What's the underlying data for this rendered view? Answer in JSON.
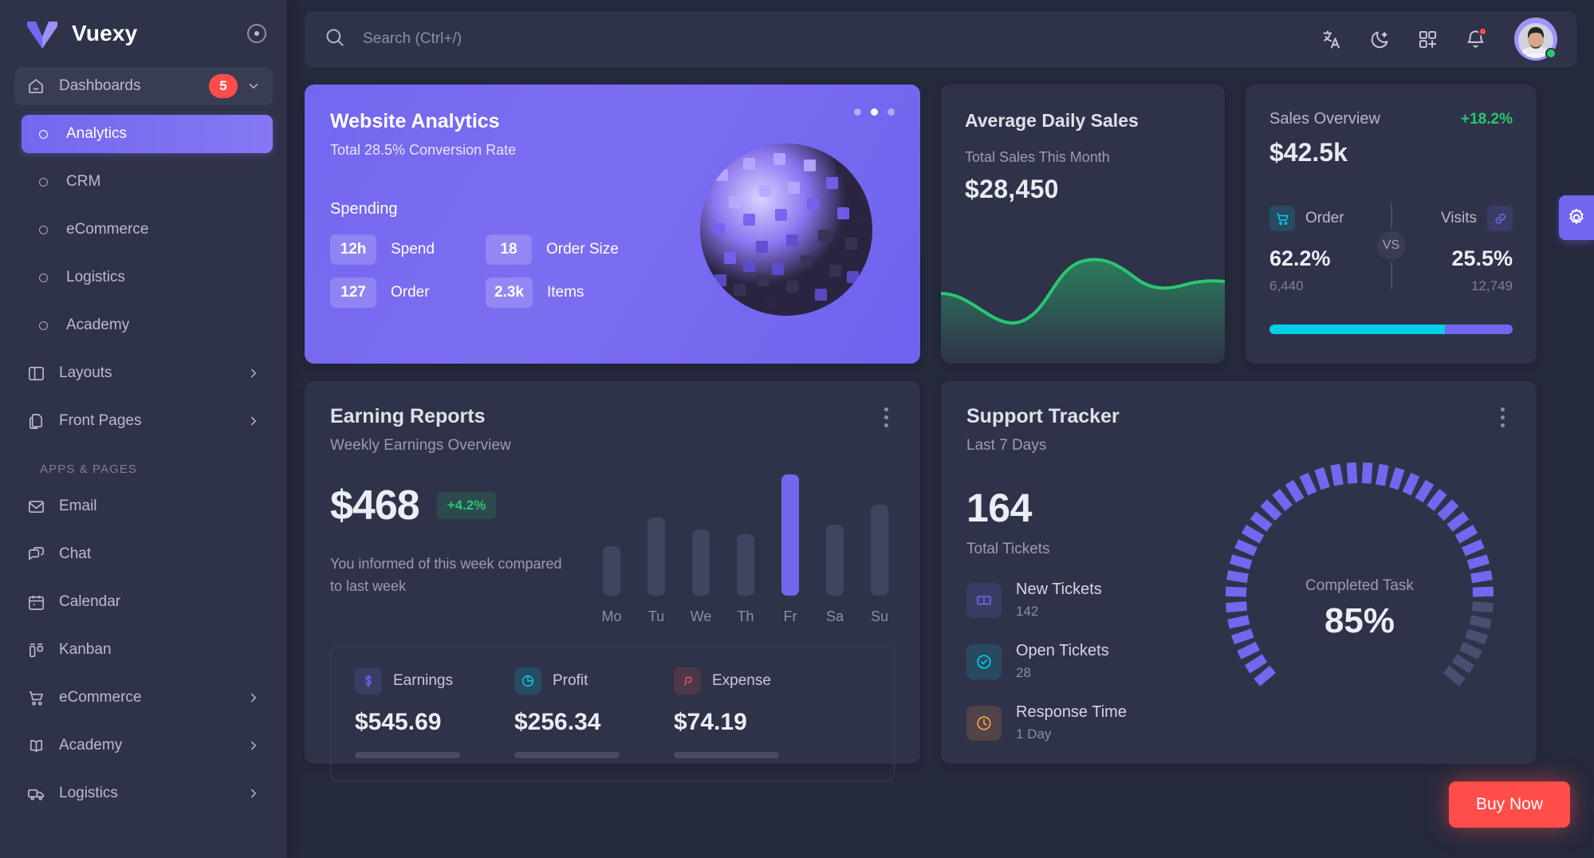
{
  "brand": {
    "name": "Vuexy",
    "collapse_icon": "circle-dot-icon"
  },
  "sidebar": {
    "group": {
      "label": "Dashboards",
      "badge": "5",
      "icon": "home-icon"
    },
    "dash_items": [
      {
        "label": "Analytics",
        "active": true
      },
      {
        "label": "CRM",
        "active": false
      },
      {
        "label": "eCommerce",
        "active": false
      },
      {
        "label": "Logistics",
        "active": false
      },
      {
        "label": "Academy",
        "active": false
      }
    ],
    "top_items": [
      {
        "label": "Layouts",
        "icon": "layout-icon",
        "arrow": true
      },
      {
        "label": "Front Pages",
        "icon": "pages-icon",
        "arrow": true
      }
    ],
    "section_label": "APPS & PAGES",
    "app_items": [
      {
        "label": "Email",
        "icon": "mail-icon",
        "arrow": false
      },
      {
        "label": "Chat",
        "icon": "chat-icon",
        "arrow": false
      },
      {
        "label": "Calendar",
        "icon": "calendar-icon",
        "arrow": false
      },
      {
        "label": "Kanban",
        "icon": "kanban-icon",
        "arrow": false
      },
      {
        "label": "eCommerce",
        "icon": "cart-icon",
        "arrow": true
      },
      {
        "label": "Academy",
        "icon": "book-icon",
        "arrow": true
      },
      {
        "label": "Logistics",
        "icon": "truck-icon",
        "arrow": true
      }
    ]
  },
  "navbar": {
    "search_placeholder": "Search (Ctrl+/)",
    "search_icon": "search-icon",
    "icons": [
      "translate-icon",
      "moon-icon",
      "grid-plus-icon",
      "bell-icon"
    ],
    "avatar_status": "online"
  },
  "website_analytics": {
    "title": "Website Analytics",
    "subtitle": "Total 28.5% Conversion Rate",
    "section": "Spending",
    "stats": [
      {
        "value": "12h",
        "label": "Spend"
      },
      {
        "value": "18",
        "label": "Order Size"
      },
      {
        "value": "127",
        "label": "Order"
      },
      {
        "value": "2.3k",
        "label": "Items"
      }
    ],
    "carousel": {
      "count": 3,
      "active": 1
    }
  },
  "average_daily_sales": {
    "title": "Average Daily Sales",
    "subtitle": "Total Sales This Month",
    "amount": "$28,450",
    "line_color": "#28c76f"
  },
  "sales_overview": {
    "title": "Sales Overview",
    "change": "+18.2%",
    "amount": "$42.5k",
    "vs_label": "VS",
    "left": {
      "name": "Order",
      "icon": "cart-icon",
      "percent": "62.2%",
      "count": "6,440",
      "color": "#00cfe8"
    },
    "right": {
      "name": "Visits",
      "icon": "link-icon",
      "percent": "25.5%",
      "count": "12,749",
      "color": "#7367f0"
    },
    "bar_split": 72
  },
  "earning_reports": {
    "title": "Earning Reports",
    "subtitle": "Weekly Earnings Overview",
    "amount": "$468",
    "change": "+4.2%",
    "note": "You informed of this week compared to last week",
    "menu_icon": "kebab-menu-icon",
    "stats": [
      {
        "name": "Earnings",
        "value": "$545.69",
        "icon": "dollar-icon",
        "color": "#7367f0",
        "progress": 66
      },
      {
        "name": "Profit",
        "value": "$256.34",
        "icon": "pie-chart-icon",
        "color": "#00cfe8",
        "progress": 52
      },
      {
        "name": "Expense",
        "value": "$74.19",
        "icon": "paypal-icon",
        "color": "#ea5455",
        "progress": 66
      }
    ]
  },
  "support_tracker": {
    "title": "Support Tracker",
    "subtitle": "Last 7 Days",
    "menu_icon": "kebab-menu-icon",
    "total": "164",
    "total_label": "Total Tickets",
    "tickets": [
      {
        "name": "New Tickets",
        "value": "142",
        "icon": "ticket-icon",
        "color": "#7367f0"
      },
      {
        "name": "Open Tickets",
        "value": "28",
        "icon": "check-circle-icon",
        "color": "#00cfe8"
      },
      {
        "name": "Response Time",
        "value": "1 Day",
        "icon": "clock-icon",
        "color": "#ff9f43"
      }
    ],
    "gauge": {
      "caption": "Completed Task",
      "percent": "85%",
      "value": 85,
      "color": "#7367f0"
    }
  },
  "floating": {
    "buy_now": "Buy Now",
    "settings_icon": "gear-icon"
  },
  "chart_data": [
    {
      "type": "area",
      "title": "Average Daily Sales",
      "series": [
        {
          "name": "Sales",
          "values": [
            42,
            38,
            30,
            24,
            22,
            26,
            46,
            74,
            86,
            88,
            82,
            72,
            66,
            64,
            65
          ]
        }
      ],
      "x": [
        0,
        1,
        2,
        3,
        4,
        5,
        6,
        7,
        8,
        9,
        10,
        11,
        12,
        13,
        14
      ],
      "ylim": [
        0,
        100
      ],
      "grid": false,
      "legend": "none",
      "line_color": "#28c76f"
    },
    {
      "type": "bar",
      "title": "Earning Reports",
      "xlabel": "",
      "ylabel": "",
      "categories": [
        "Mo",
        "Tu",
        "We",
        "Th",
        "Fr",
        "Sa",
        "Su"
      ],
      "values": [
        52,
        82,
        70,
        65,
        128,
        75,
        96
      ],
      "ylim": [
        0,
        140
      ],
      "highlight_index": 4,
      "grid": false,
      "legend": "none"
    },
    {
      "type": "radial",
      "title": "Completed Task",
      "values": [
        85
      ],
      "ylim": [
        0,
        100
      ],
      "labels": [
        "Completed Task"
      ],
      "annotations": [
        "85%"
      ],
      "ticks": 38
    }
  ]
}
